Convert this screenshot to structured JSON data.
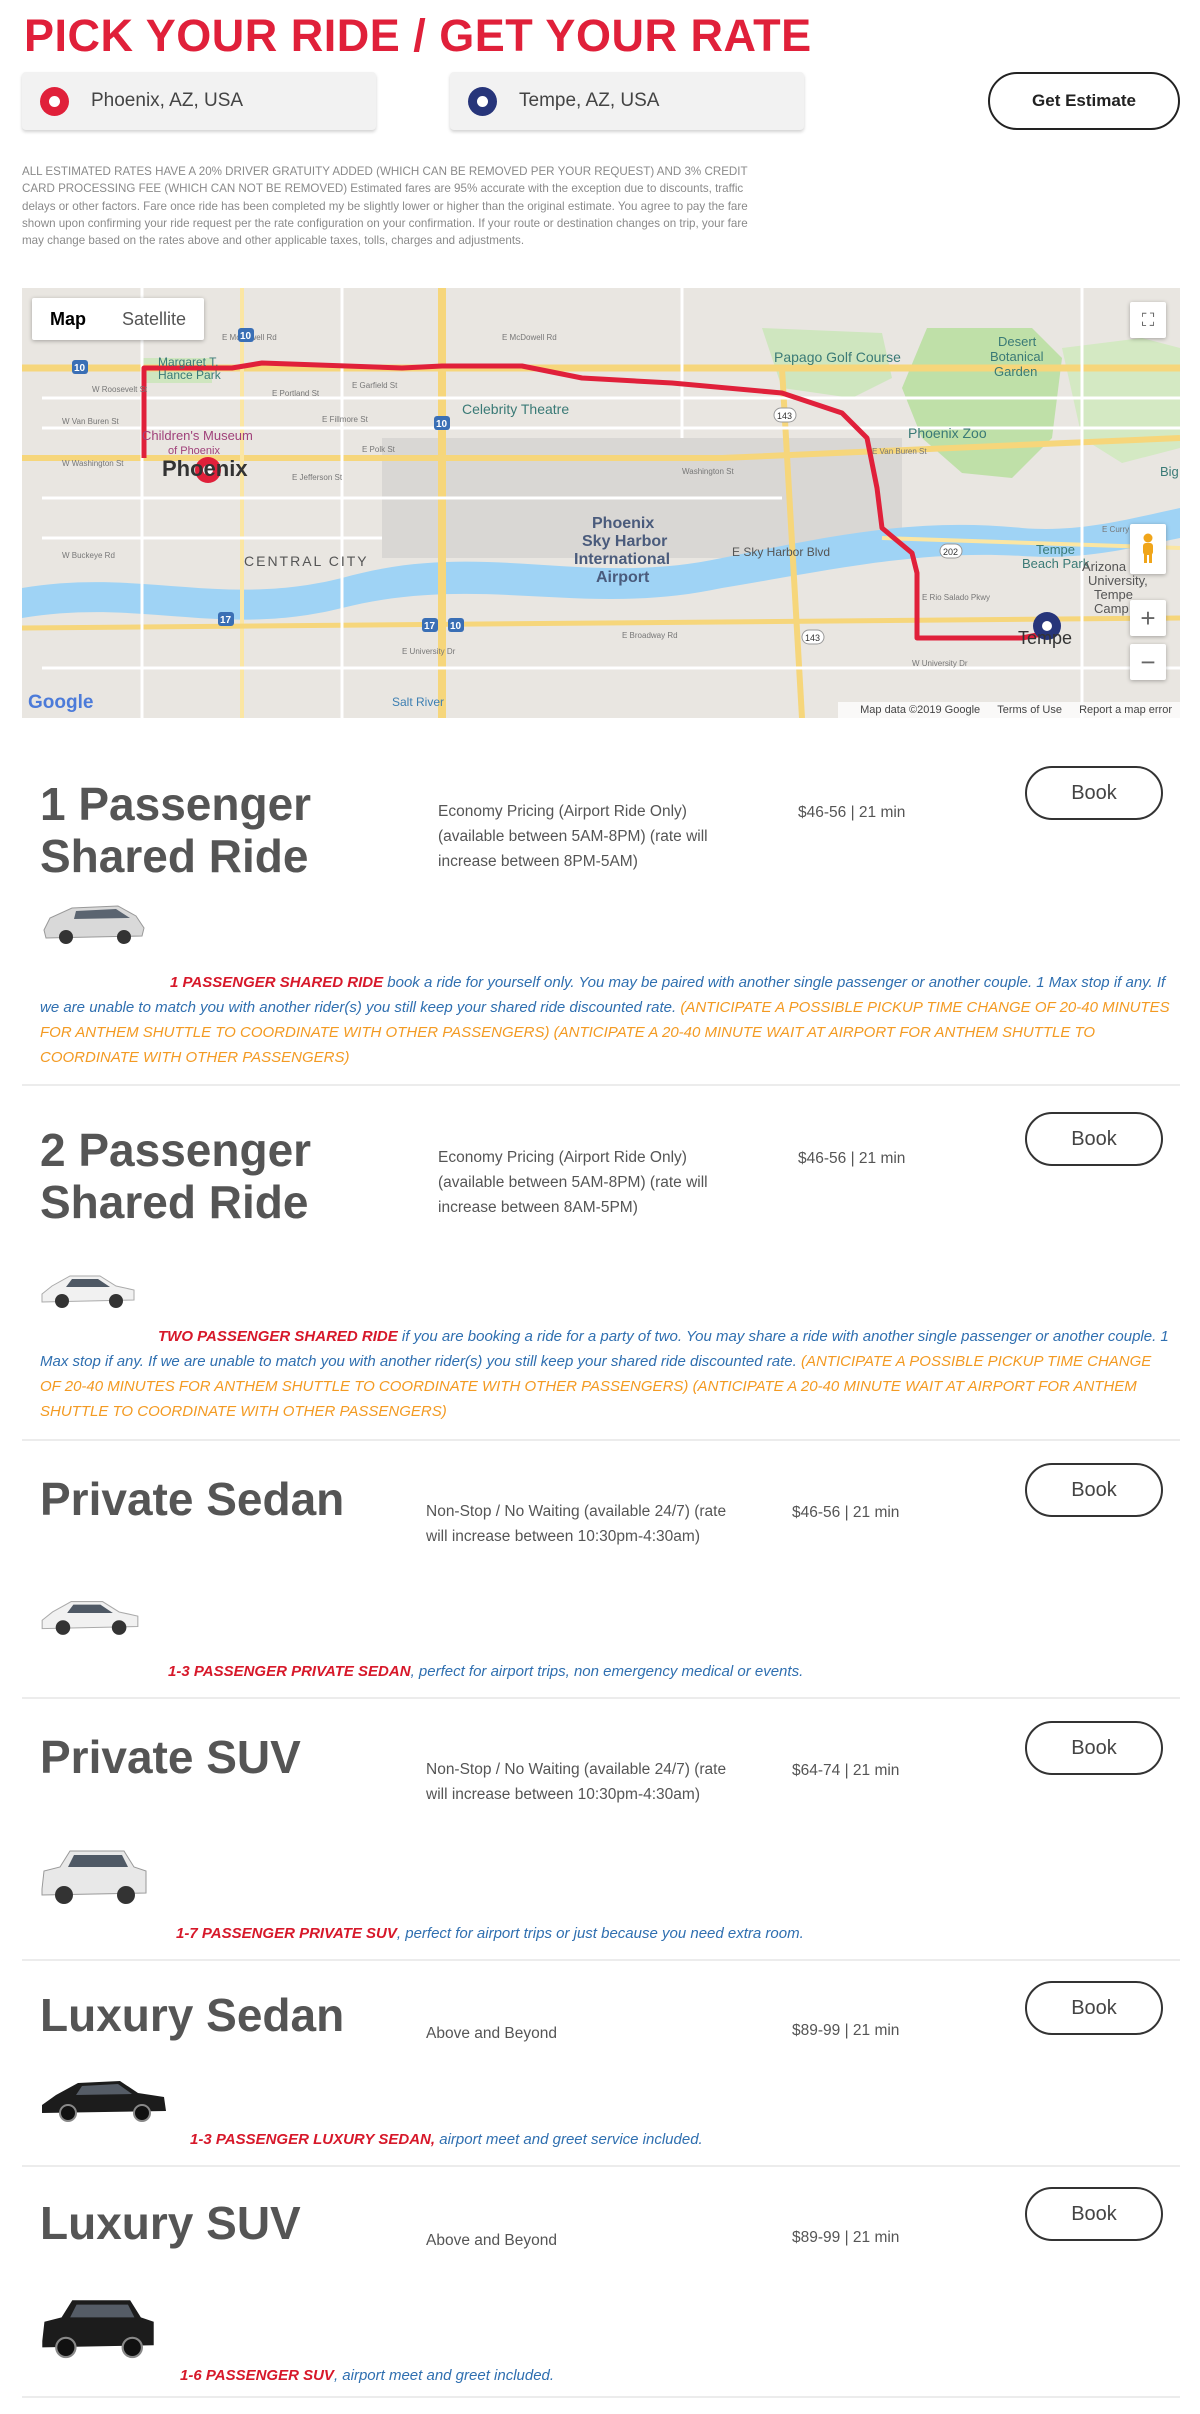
{
  "header": {
    "title": "PICK YOUR RIDE / GET YOUR RATE"
  },
  "locations": {
    "from": "Phoenix, AZ, USA",
    "to": "Tempe, AZ, USA"
  },
  "estimate_button": "Get Estimate",
  "disclaimer": "ALL ESTIMATED RATES HAVE A 20% DRIVER GRATUITY ADDED (WHICH CAN BE REMOVED PER YOUR REQUEST) AND 3% CREDIT CARD PROCESSING FEE (WHICH CAN NOT BE REMOVED) Estimated fares are 95% accurate with the exception due to discounts, traffic delays or other factors. Fare once ride has been completed my be slightly lower or higher than the original estimate. You agree to pay the fare shown upon confirming your ride request per the rate configuration on your confirmation. If your route or destination changes on trip, your fare may change based on the rates above and other applicable taxes, tolls, charges and adjustments.",
  "map": {
    "type_map": "Map",
    "type_satellite": "Satellite",
    "attribution": "Map data ©2019 Google",
    "terms": "Terms of Use",
    "report": "Report a map error",
    "logo": "Google",
    "labels": {
      "phoenix": "Phoenix",
      "tempe": "Tempe",
      "central_city": "CENTRAL CITY",
      "airport_1": "Phoenix",
      "airport_2": "Sky Harbor",
      "airport_3": "International",
      "airport_4": "Airport",
      "celebrity": "Celebrity Theatre",
      "papago": "Papago Golf Course",
      "desert_1": "Desert",
      "desert_2": "Botanical",
      "desert_3": "Garden",
      "zoo": "Phoenix Zoo",
      "childrens_1": "Children's Museum",
      "childrens_2": "of Phoenix",
      "margaret_1": "Margaret T.",
      "margaret_2": "Hance Park",
      "tempe_beach_1": "Tempe",
      "tempe_beach_2": "Beach Park",
      "asu_1": "Arizona State",
      "asu_2": "University,",
      "asu_3": "Tempe",
      "asu_4": "Camp",
      "sky_harbor_blvd": "E Sky Harbor Blvd",
      "salt_river": "Salt River",
      "big": "Big",
      "mcdowell_1": "E McDowell Rd",
      "mcdowell_2": "E McDowell Rd",
      "van_buren_1": "E Van Buren St",
      "van_buren_2": "W Van Buren St",
      "washington_1": "Washington St",
      "washington_2": "W Washington St",
      "jefferson": "E Jefferson St",
      "buckeye": "W Buckeye Rd",
      "university_1": "E University Dr",
      "university_2": "W University Dr",
      "curry": "E Curry Rd",
      "roosevelt": "W Roosevelt St",
      "fillmore": "E Fillmore St",
      "polk": "E Polk St",
      "portland": "E Portland St",
      "garfield": "E Garfield St",
      "broadway": "E Broadway Rd",
      "rio_salado": "E Rio Salado Pkwy",
      "i10_a": "10",
      "i10_b": "10",
      "i10_c": "10",
      "i17_a": "17",
      "i17_b": "17",
      "sr143_a": "143",
      "sr143_b": "143",
      "sr202": "202",
      "i10_shield": "10"
    }
  },
  "rides": [
    {
      "title_1": "1 Passenger",
      "title_2": "Shared Ride",
      "desc": "Economy Pricing (Airport Ride Only) (available between 5AM-8PM) (rate will increase between 8PM-5AM)",
      "price": "$46-56 | 21 min",
      "book": "Book",
      "note_red": "1 PASSENGER SHARED RIDE",
      "note_blue": " book a ride for yourself only. You may be paired with another single passenger or another couple. 1 Max stop if any. If we are unable to match you with another rider(s) you still keep your shared ride discounted rate.",
      "note_orange": " (ANTICIPATE A POSSIBLE PICKUP TIME CHANGE OF 20-40 MINUTES FOR ANTHEM SHUTTLE TO COORDINATE WITH OTHER PASSENGERS) (ANTICIPATE A 20-40 MINUTE WAIT AT AIRPORT FOR ANTHEM SHUTTLE TO COORDINATE WITH OTHER PASSENGERS)",
      "car_color": "#d9d9d9"
    },
    {
      "title_1": "2 Passenger",
      "title_2": "Shared Ride",
      "desc": "Economy Pricing (Airport Ride Only) (available between 5AM-8PM) (rate will increase between 8AM-5PM)",
      "price": "$46-56 | 21 min",
      "book": "Book",
      "note_red": "TWO PASSENGER SHARED RIDE",
      "note_blue": " if you are booking a ride for a party of two. You may share a ride with another single passenger or another couple. 1 Max stop if any. If we are unable to match you with another rider(s) you still keep your shared ride discounted rate.",
      "note_orange": " (ANTICIPATE A POSSIBLE PICKUP TIME CHANGE OF 20-40 MINUTES FOR ANTHEM SHUTTLE TO COORDINATE WITH OTHER PASSENGERS) (ANTICIPATE A 20-40 MINUTE WAIT AT AIRPORT FOR ANTHEM SHUTTLE TO COORDINATE WITH OTHER PASSENGERS)",
      "car_color": "#f1f1f1"
    },
    {
      "title_1": "Private Sedan",
      "desc": "Non-Stop / No Waiting (available 24/7) (rate will increase between 10:30pm-4:30am)",
      "price": "$46-56 | 21 min",
      "book": "Book",
      "note_red": "1-3 PASSENGER PRIVATE SEDAN",
      "note_blue": ", perfect for airport trips, non emergency medical or events.",
      "car_color": "#f1f1f1"
    },
    {
      "title_1": "Private SUV",
      "desc": "Non-Stop / No Waiting (available 24/7) (rate will increase between 10:30pm-4:30am)",
      "price": "$64-74 | 21 min",
      "book": "Book",
      "note_red": "1-7 PASSENGER PRIVATE SUV",
      "note_blue": ", perfect for airport trips or just because you need extra room.",
      "car_color": "#e8e8e8"
    },
    {
      "title_1": "Luxury Sedan",
      "desc": "Above and Beyond",
      "price": "$89-99 | 21 min",
      "book": "Book",
      "note_red": "1-3 PASSENGER LUXURY SEDAN,",
      "note_blue": " airport meet and greet service included.",
      "car_color": "#1c1c1c"
    },
    {
      "title_1": "Luxury SUV",
      "desc": "Above and Beyond",
      "price": "$89-99 | 21 min",
      "book": "Book",
      "note_red": "1-6 PASSENGER SUV",
      "note_blue": ", airport meet and greet included.",
      "car_color": "#1c1c1c"
    }
  ]
}
